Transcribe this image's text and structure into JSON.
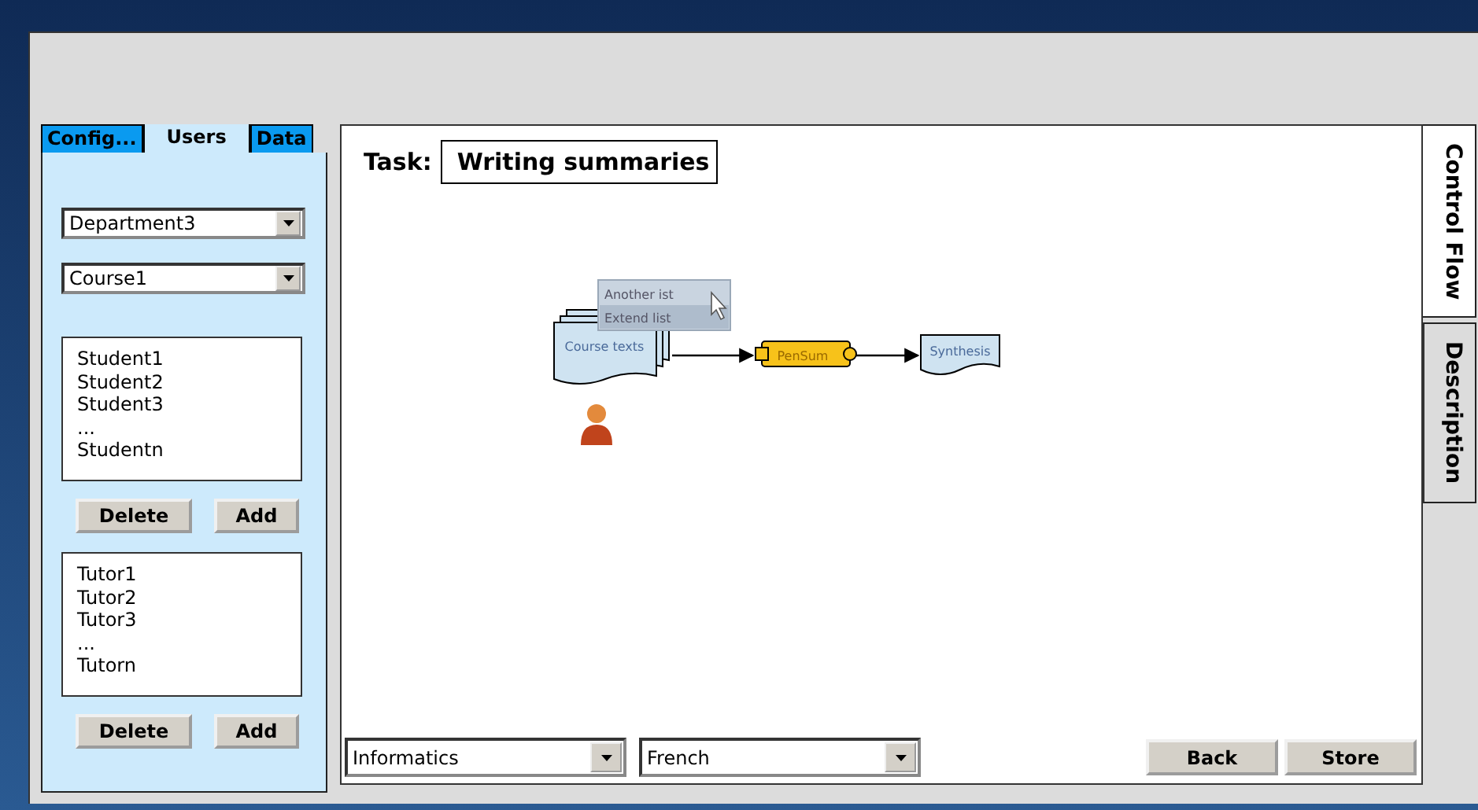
{
  "left_tabs": [
    {
      "label": "Config...",
      "selected": false
    },
    {
      "label": "Users",
      "selected": true
    },
    {
      "label": "Data",
      "selected": false
    }
  ],
  "department": {
    "value": "Department3"
  },
  "course": {
    "value": "Course1"
  },
  "students": {
    "items": [
      "Student1",
      "Student2",
      "Student3",
      "...",
      "Studentn"
    ],
    "buttons": [
      "Delete",
      "Add"
    ]
  },
  "tutors": {
    "items": [
      "Tutor1",
      "Tutor2",
      "Tutor3",
      "...",
      "Tutorn"
    ],
    "buttons": [
      "Delete",
      "Add"
    ]
  },
  "task": {
    "label": "Task:",
    "value": "Writing summaries"
  },
  "diagram": {
    "nodes": [
      {
        "kind": "document-stack",
        "label": "Course texts"
      },
      {
        "kind": "component",
        "label": "PenSum"
      },
      {
        "kind": "document",
        "label": "Synthesis"
      }
    ],
    "context_menu": [
      {
        "label": "Another ist",
        "selected": false
      },
      {
        "label": "Extend list",
        "selected": true
      }
    ]
  },
  "bottom": {
    "subject": {
      "value": "Informatics"
    },
    "language": {
      "value": "French"
    },
    "buttons": [
      "Back",
      "Store"
    ]
  },
  "side_tabs": [
    {
      "label": "Control Flow",
      "selected": true
    },
    {
      "label": "Description",
      "selected": false
    }
  ]
}
